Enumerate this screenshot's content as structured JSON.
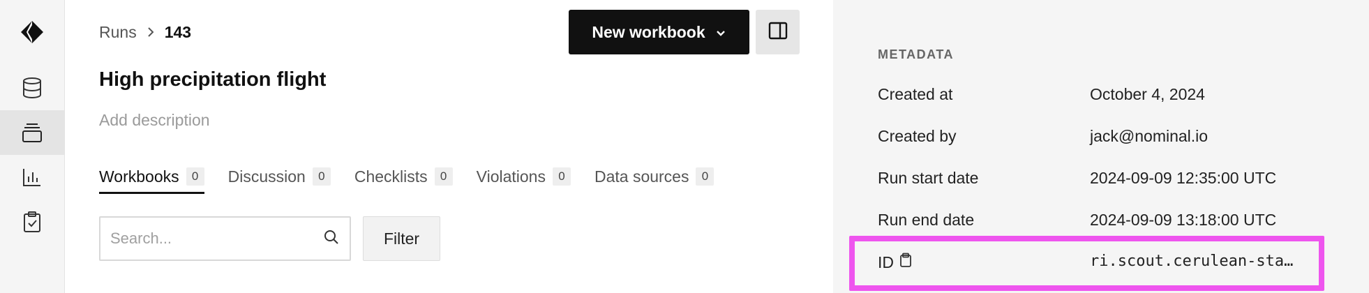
{
  "rail": {
    "items": [
      {
        "icon": "diamond-logo-icon"
      },
      {
        "icon": "database-icon"
      },
      {
        "icon": "stacked-layers-icon",
        "active": true
      },
      {
        "icon": "bar-chart-icon"
      },
      {
        "icon": "clipboard-check-icon"
      }
    ]
  },
  "breadcrumb": {
    "parent": "Runs",
    "current": "143"
  },
  "toolbar": {
    "new_workbook_label": "New workbook"
  },
  "run": {
    "title": "High precipitation flight",
    "description_placeholder": "Add description"
  },
  "tabs": [
    {
      "label": "Workbooks",
      "count": "0",
      "active": true
    },
    {
      "label": "Discussion",
      "count": "0"
    },
    {
      "label": "Checklists",
      "count": "0"
    },
    {
      "label": "Violations",
      "count": "0"
    },
    {
      "label": "Data sources",
      "count": "0"
    }
  ],
  "search": {
    "placeholder": "Search..."
  },
  "filter": {
    "label": "Filter"
  },
  "metadata": {
    "heading": "METADATA",
    "rows": [
      {
        "label": "Created at",
        "value": "October 4, 2024"
      },
      {
        "label": "Created by",
        "value": "jack@nominal.io"
      },
      {
        "label": "Run start date",
        "value": "2024-09-09 12:35:00 UTC"
      },
      {
        "label": "Run end date",
        "value": "2024-09-09 13:18:00 UTC"
      },
      {
        "label": "ID",
        "value": "ri.scout.cerulean-sta…"
      }
    ]
  },
  "colors": {
    "accent": "#111111",
    "highlight": "#ee55ee",
    "panel_bg": "#f5f5f5"
  }
}
